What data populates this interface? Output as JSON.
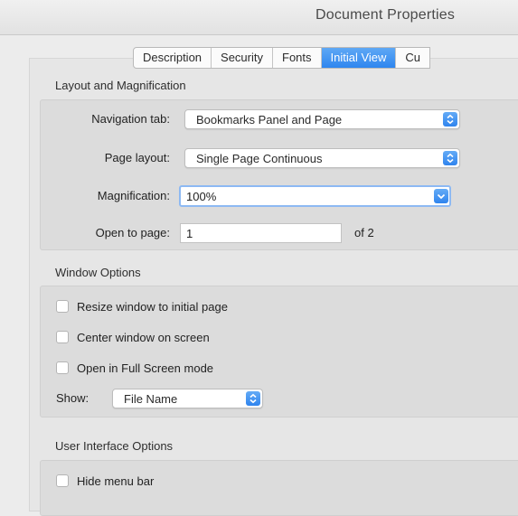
{
  "window": {
    "title": "Document Properties"
  },
  "tabs": [
    {
      "label": "Description",
      "active": false
    },
    {
      "label": "Security",
      "active": false
    },
    {
      "label": "Fonts",
      "active": false
    },
    {
      "label": "Initial View",
      "active": true
    },
    {
      "label": "Cu",
      "active": false
    }
  ],
  "layout_section": {
    "title": "Layout and Magnification",
    "navigation_tab": {
      "label": "Navigation tab:",
      "value": "Bookmarks Panel and Page"
    },
    "page_layout": {
      "label": "Page layout:",
      "value": "Single Page Continuous"
    },
    "magnification": {
      "label": "Magnification:",
      "value": "100%"
    },
    "open_to_page": {
      "label": "Open to page:",
      "value": "1",
      "of_text": "of 2"
    }
  },
  "window_section": {
    "title": "Window Options",
    "resize": {
      "label": "Resize window to initial page",
      "checked": false
    },
    "center": {
      "label": "Center window on screen",
      "checked": false
    },
    "fullscreen": {
      "label": "Open in Full Screen mode",
      "checked": false
    },
    "show": {
      "label": "Show:",
      "value": "File Name"
    }
  },
  "ui_section": {
    "title": "User Interface Options",
    "hide_menu_bar": {
      "label": "Hide menu bar",
      "checked": false
    }
  },
  "colors": {
    "accent": "#2f86ef",
    "window_bg": "#ececec",
    "group_bg": "#dcdcdc"
  },
  "icons": {
    "popup": "up-down-chevron-icon",
    "combo": "chevron-down-icon"
  }
}
